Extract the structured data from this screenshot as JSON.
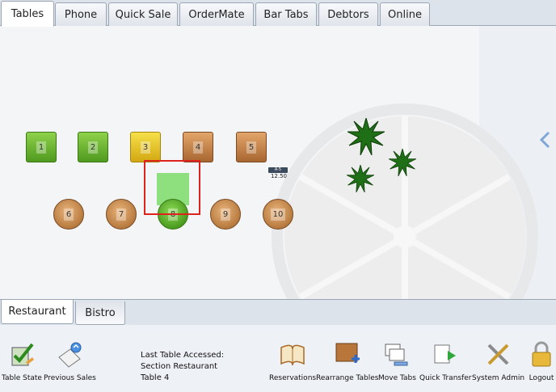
{
  "top_tabs": [
    "Tables",
    "Phone",
    "Quick Sale",
    "OrderMate",
    "Bar Tabs",
    "Debtors",
    "Online"
  ],
  "tables": {
    "t1": "1",
    "t2": "2",
    "t3": "3",
    "t4": "4",
    "t5": "5",
    "t6": "6",
    "t7": "7",
    "t8": "8",
    "t9": "9",
    "t10": "10"
  },
  "tab_badge": {
    "label": "A·5",
    "amount": "12.50"
  },
  "section_tabs": [
    "Restaurant",
    "Bistro"
  ],
  "last_accessed": {
    "heading": "Last Table Accessed:",
    "section": "Section Restaurant",
    "table": "Table 4"
  },
  "toolbar": {
    "table_state": "Table State",
    "previous_sales": "Previous Sales",
    "reservations": "Reservations",
    "rearrange_tables": "Rearrange Tables",
    "move_tabs": "Move Tabs",
    "quick_transfer": "Quick Transfer",
    "system_admin": "System Admin",
    "logout": "Logout"
  },
  "colors": {
    "selection_border": "#e0221c",
    "selected_highlight": "#8ee07f"
  }
}
